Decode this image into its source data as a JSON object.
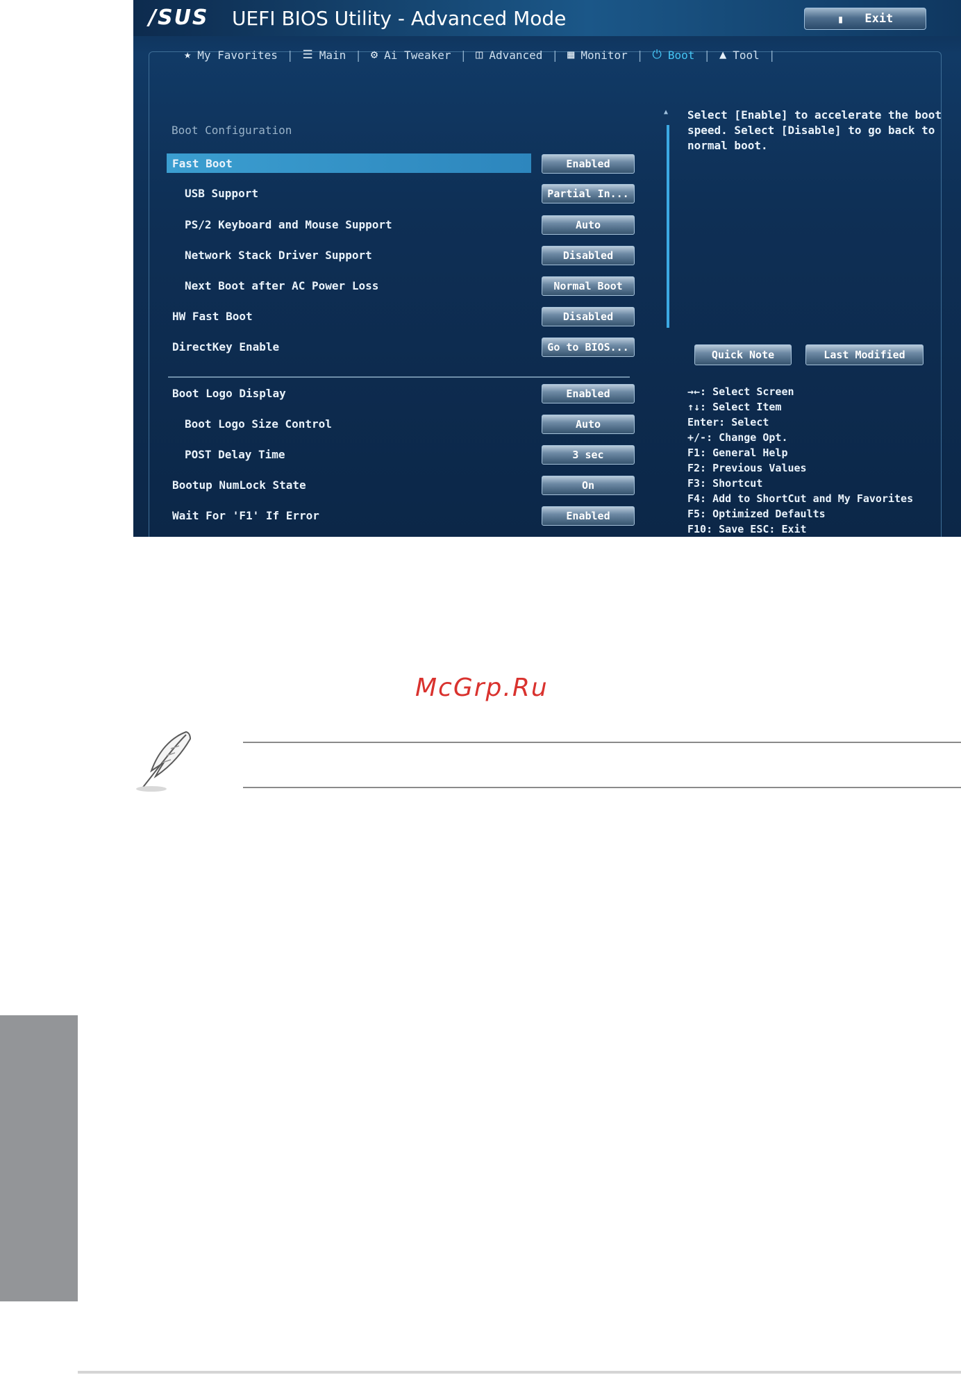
{
  "bios": {
    "logo": "/SUS",
    "title": "UEFI BIOS Utility - Advanced Mode",
    "exit_label": "Exit",
    "tabs": [
      {
        "label": "My Favorites"
      },
      {
        "label": "Main"
      },
      {
        "label": "Ai Tweaker"
      },
      {
        "label": "Advanced"
      },
      {
        "label": "Monitor"
      },
      {
        "label": "Boot"
      },
      {
        "label": "Tool"
      }
    ],
    "section_heading": "Boot Configuration",
    "settings": [
      {
        "label": "Fast Boot",
        "value": "Enabled"
      },
      {
        "label": "USB Support",
        "value": "Partial In..."
      },
      {
        "label": "PS/2 Keyboard and Mouse Support",
        "value": "Auto"
      },
      {
        "label": "Network Stack Driver Support",
        "value": "Disabled"
      },
      {
        "label": "Next Boot after AC Power Loss",
        "value": "Normal Boot"
      },
      {
        "label": "HW Fast Boot",
        "value": "Disabled"
      },
      {
        "label": "DirectKey Enable",
        "value": "Go to BIOS..."
      },
      {
        "label": "Boot Logo Display",
        "value": "Enabled"
      },
      {
        "label": "Boot Logo Size Control",
        "value": "Auto"
      },
      {
        "label": "POST Delay Time",
        "value": "3 sec"
      },
      {
        "label": "Bootup NumLock State",
        "value": "On"
      },
      {
        "label": "Wait For 'F1' If Error",
        "value": "Enabled"
      }
    ],
    "help_text": "Select [Enable] to accelerate the boot speed. Select [Disable] to go back to normal boot.",
    "quick_note_label": "Quick Note",
    "last_modified_label": "Last Modified",
    "shortcuts": [
      "→←: Select Screen",
      "↑↓: Select Item",
      "Enter: Select",
      "+/-: Change Opt.",
      "F1: General Help",
      "F2: Previous Values",
      "F3: Shortcut",
      "F4: Add to ShortCut and My Favorites",
      "F5: Optimized Defaults",
      "F10: Save  ESC: Exit"
    ],
    "accent_color": "#45c6f5"
  },
  "page": {
    "watermark": "McGrp.Ru"
  }
}
